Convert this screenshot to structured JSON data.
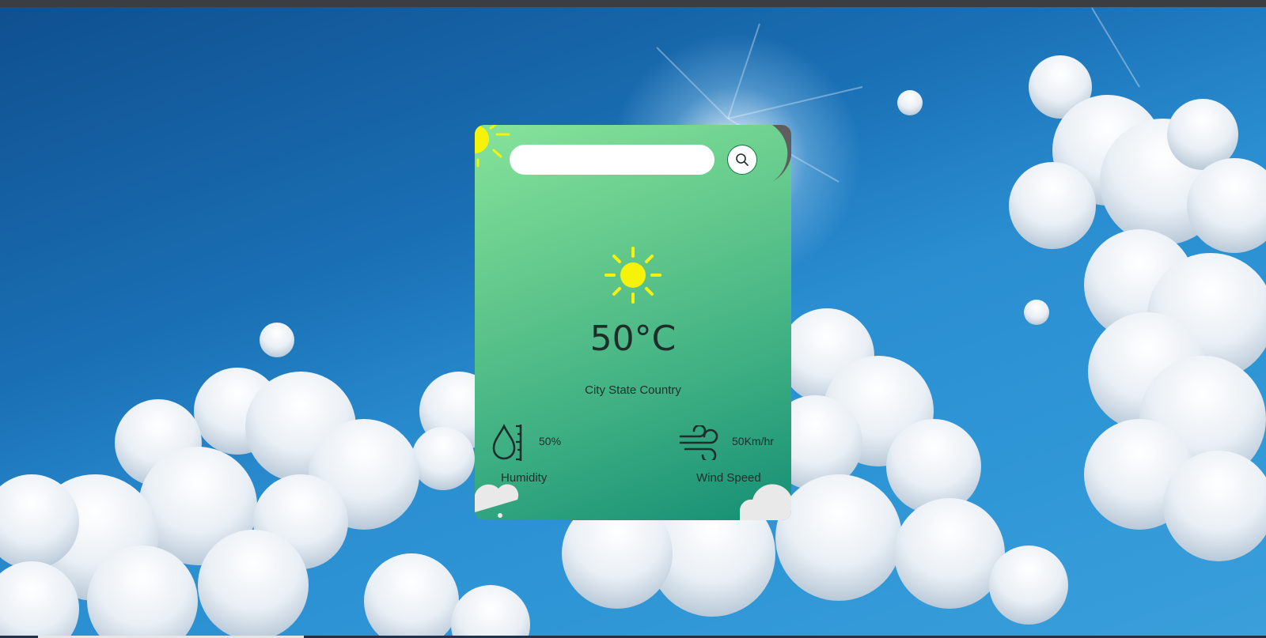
{
  "search": {
    "value": "",
    "placeholder": "",
    "button_icon": "search-icon"
  },
  "weather": {
    "icon": "sun-icon",
    "temperature": "50°C",
    "location": "City State Country"
  },
  "stats": {
    "humidity": {
      "icon": "humidity-icon",
      "value": "50%",
      "label": "Humidity"
    },
    "wind": {
      "icon": "wind-icon",
      "value": "50Km/hr",
      "label": "Wind Speed"
    }
  },
  "colors": {
    "card_gradient_start": "#86e39a",
    "card_gradient_end": "#158e74",
    "sun": "#f7f20a",
    "text": "#1d2e2a",
    "search_button_border": "#0b7a3a",
    "sky": "#2a8ed1"
  }
}
